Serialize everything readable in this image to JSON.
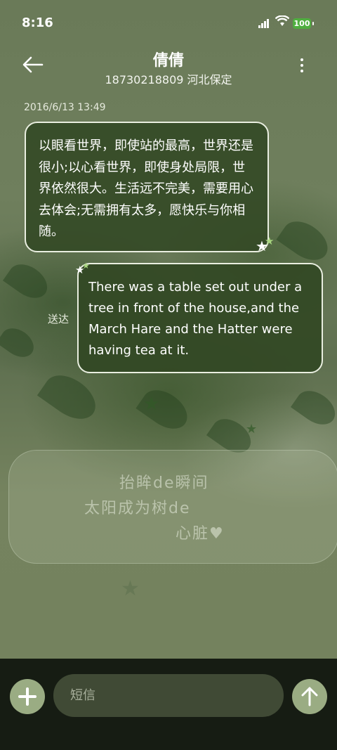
{
  "status_bar": {
    "time": "8:16",
    "battery": "100"
  },
  "header": {
    "title": "倩倩",
    "subtitle": "18730218809 河北保定"
  },
  "messages": {
    "timestamp": "2016/6/13 13:49",
    "incoming_text": "以眼看世界，即使站的最高，世界还是很小;以心看世界，即使身处局限，世界依然很大。生活远不完美，需要用心去体会;无需拥有太多，愿快乐与你相随。",
    "outgoing_text": "There was a table set out under a tree in front of the house,and the March Hare and the Hatter were having tea at it.",
    "delivered_label": "送达"
  },
  "wallpaper_text": [
    "抬眸de瞬间",
    "太阳成为树de",
    "心脏♥"
  ],
  "composer": {
    "placeholder": "短信"
  },
  "icons": {
    "back": "arrow-left-icon",
    "more": "more-vertical-icon",
    "add": "plus-icon",
    "send": "arrow-up-icon"
  },
  "colors": {
    "accent": "#9aac83",
    "bubble": "#344a26",
    "bottom_bar": "#161c13"
  }
}
